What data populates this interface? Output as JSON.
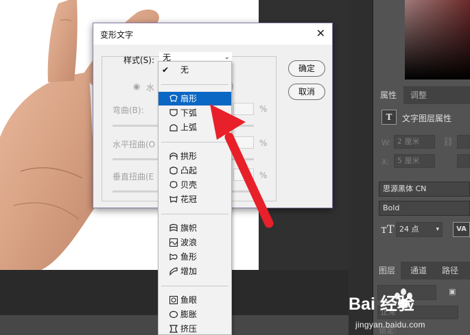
{
  "dialog": {
    "title": "变形文字",
    "style_label": "样式(S):",
    "style_value": "无",
    "ok_label": "确定",
    "cancel_label": "取消",
    "orientation_partial": "水",
    "bend_label": "弯曲(B):",
    "h_distort_label": "水平扭曲(O",
    "v_distort_label": "垂直扭曲(E",
    "percent": "%"
  },
  "dropdown": {
    "items": [
      {
        "label": "无",
        "icon": "check-icon"
      },
      {
        "label": "扇形",
        "icon": "arc-icon",
        "selected": true
      },
      {
        "label": "下弧",
        "icon": "arc-lower-icon"
      },
      {
        "label": "上弧",
        "icon": "arc-upper-icon"
      },
      {
        "label": "拱形",
        "icon": "arch-icon"
      },
      {
        "label": "凸起",
        "icon": "bulge-icon"
      },
      {
        "label": "贝壳",
        "icon": "shell-icon"
      },
      {
        "label": "花冠",
        "icon": "flower-icon"
      },
      {
        "label": "旗帜",
        "icon": "flag-icon"
      },
      {
        "label": "波浪",
        "icon": "wave-icon"
      },
      {
        "label": "鱼形",
        "icon": "fish-icon"
      },
      {
        "label": "增加",
        "icon": "rise-icon"
      },
      {
        "label": "鱼眼",
        "icon": "fisheye-icon"
      },
      {
        "label": "膨胀",
        "icon": "inflate-icon"
      },
      {
        "label": "挤压",
        "icon": "squeeze-icon"
      }
    ]
  },
  "panel": {
    "tab_properties": "属性",
    "tab_adjustments": "调整",
    "type_layer_label": "文字图层属性",
    "w_label": "W:",
    "w_value": "2 厘米",
    "x_label": "X:",
    "x_value": "5 厘米",
    "font_family": "思源黑体 CN",
    "font_style": "Bold",
    "font_size": "24 点",
    "va_label": "VA",
    "tab_layers": "图层",
    "tab_channels": "通道",
    "tab_paths": "路径",
    "lock_label": "锁定:",
    "normal_label": "正常"
  },
  "watermark": {
    "logo": "Bai 经验",
    "url": "jingyan.baidu.com"
  },
  "colors": {
    "selection": "#0a67c4",
    "arrow": "#e8202a",
    "dialog_border": "#8a7aa8"
  }
}
